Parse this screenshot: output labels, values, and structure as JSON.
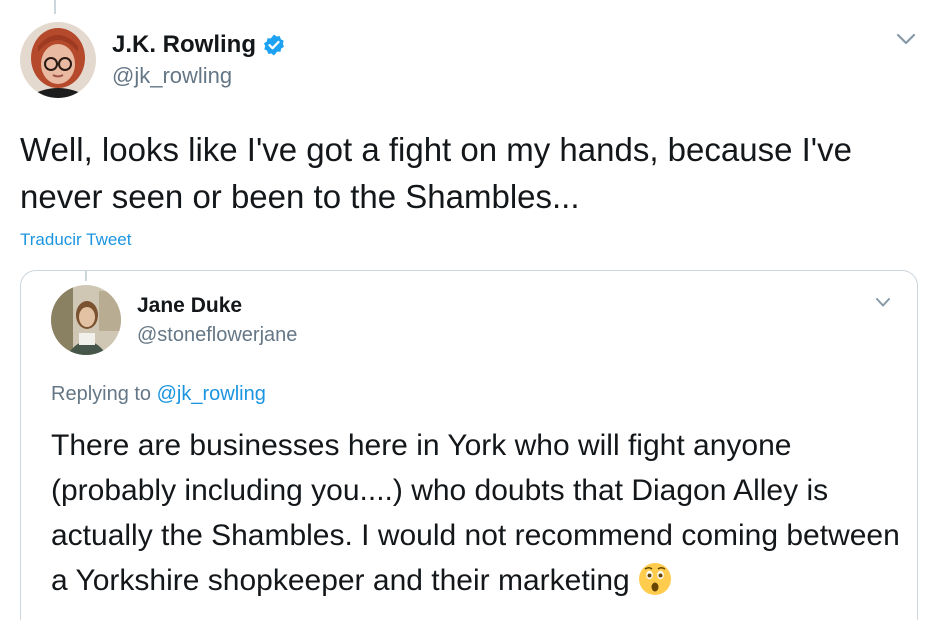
{
  "tweet": {
    "author": {
      "display_name": "J.K. Rowling",
      "handle": "@jk_rowling",
      "verified": true,
      "avatar_icon": "profile-photo-red-hair-glasses"
    },
    "text": "Well, looks like I've got a fight on my hands, because I've never seen or been to the Shambles...",
    "translate_label": "Traducir Tweet",
    "menu_icon": "chevron-down-icon"
  },
  "quoted_tweet": {
    "author": {
      "display_name": "Jane Duke",
      "handle": "@stoneflowerjane",
      "avatar_icon": "profile-photo-woman-in-shop"
    },
    "replying_prefix": "Replying to",
    "replying_to": "@jk_rowling",
    "text": "There are businesses here in York who will fight anyone (probably including you....) who doubts that Diagon Alley is actually the Shambles. I would not recommend coming between a Yorkshire shopkeeper and their marketing",
    "emoji": "astonished-face-emoji",
    "menu_icon": "chevron-down-icon"
  },
  "colors": {
    "link": "#1b95e0",
    "secondary_text": "#657786",
    "primary_text": "#14171a",
    "border": "#ccd6dd",
    "verified_badge": "#1da1f2"
  }
}
